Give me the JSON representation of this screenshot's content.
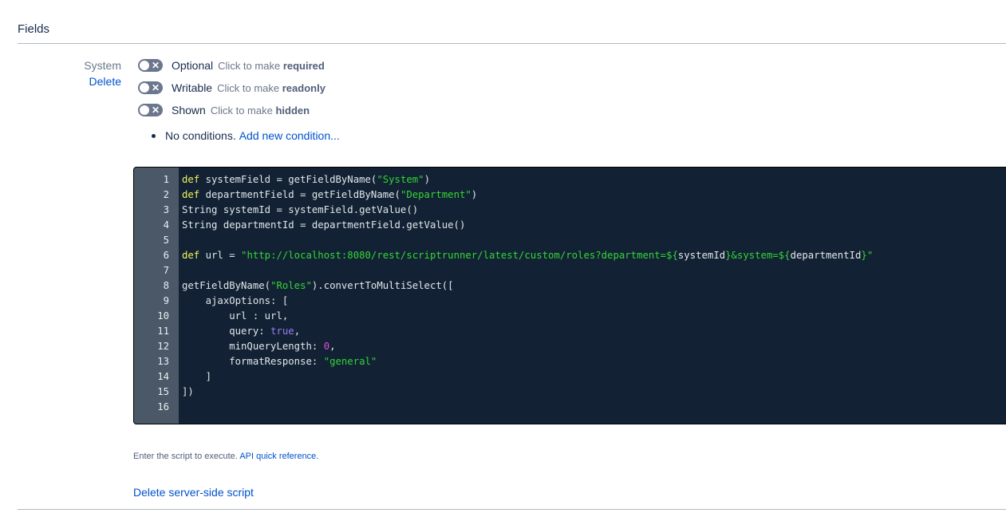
{
  "section": {
    "title": "Fields"
  },
  "field": {
    "name": "System",
    "delete_label": "Delete",
    "toggles": [
      {
        "state": "Optional",
        "hint": "Click to make",
        "target": "required"
      },
      {
        "state": "Writable",
        "hint": "Click to make",
        "target": "readonly"
      },
      {
        "state": "Shown",
        "hint": "Click to make",
        "target": "hidden"
      }
    ],
    "conditions": {
      "text": "No conditions.",
      "link": "Add new condition..."
    }
  },
  "editor": {
    "line_numbers": [
      "1",
      "2",
      "3",
      "4",
      "5",
      "6",
      "7",
      "8",
      "9",
      "10",
      "11",
      "12",
      "13",
      "14",
      "15",
      "16"
    ],
    "lines": [
      [
        [
          "kw",
          "def"
        ],
        [
          "p",
          " systemField = getFieldByName("
        ],
        [
          "str",
          "\"System\""
        ],
        [
          "p",
          ")"
        ]
      ],
      [
        [
          "kw",
          "def"
        ],
        [
          "p",
          " departmentField = getFieldByName("
        ],
        [
          "str",
          "\"Department\""
        ],
        [
          "p",
          ")"
        ]
      ],
      [
        [
          "p",
          "String systemId = systemField.getValue()"
        ]
      ],
      [
        [
          "p",
          "String departmentId = departmentField.getValue()"
        ]
      ],
      [],
      [
        [
          "kw",
          "def"
        ],
        [
          "p",
          " url = "
        ],
        [
          "str",
          "\"http://localhost:8080/rest/scriptrunner/latest/custom/roles?department=${"
        ],
        [
          "p",
          "systemId"
        ],
        [
          "str",
          "}&system=${"
        ],
        [
          "p",
          "departmentId"
        ],
        [
          "str",
          "}\""
        ]
      ],
      [],
      [
        [
          "p",
          "getFieldByName("
        ],
        [
          "str",
          "\"Roles\""
        ],
        [
          "p",
          ").convertToMultiSelect(["
        ]
      ],
      [
        [
          "p",
          "    ajaxOptions: ["
        ]
      ],
      [
        [
          "p",
          "        url : url,"
        ]
      ],
      [
        [
          "p",
          "        query: "
        ],
        [
          "bool",
          "true"
        ],
        [
          "p",
          ","
        ]
      ],
      [
        [
          "p",
          "        minQueryLength: "
        ],
        [
          "num",
          "0"
        ],
        [
          "p",
          ","
        ]
      ],
      [
        [
          "p",
          "        formatResponse: "
        ],
        [
          "str",
          "\"general\""
        ]
      ],
      [
        [
          "p",
          "    ]"
        ]
      ],
      [
        [
          "p",
          "])"
        ]
      ],
      []
    ]
  },
  "footer": {
    "hint_text": "Enter the script to execute.",
    "hint_link": "API quick reference.",
    "delete_script": "Delete server-side script"
  }
}
